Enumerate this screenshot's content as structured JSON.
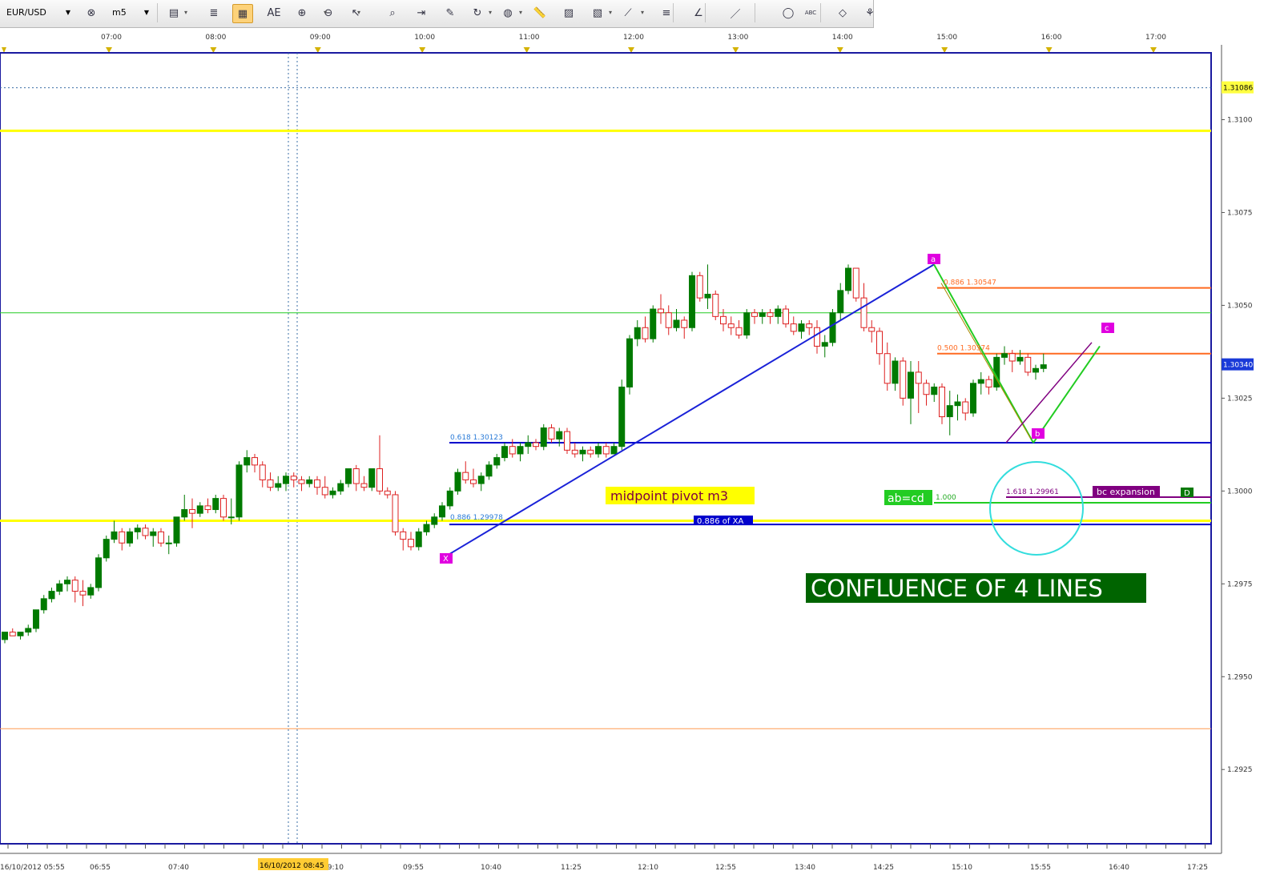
{
  "toolbar": {
    "symbol": "EUR/USD",
    "timeframe": "m5",
    "buttons": [
      {
        "name": "chart-type-icon",
        "glyph": "▤"
      },
      {
        "name": "indicator-icon",
        "glyph": "≣"
      },
      {
        "name": "data-window-icon",
        "glyph": "▦",
        "active": true
      },
      {
        "name": "text-icon",
        "glyph": "AE"
      },
      {
        "name": "zoom-in-icon",
        "glyph": "⊕"
      },
      {
        "name": "zoom-out-icon",
        "glyph": "⊖"
      },
      {
        "name": "cursor-icon",
        "glyph": "↖"
      },
      {
        "name": "zoom-area-icon",
        "glyph": "⌕"
      },
      {
        "name": "auto-scroll-icon",
        "glyph": "⇥"
      },
      {
        "name": "properties-icon",
        "glyph": "✎"
      },
      {
        "name": "refresh-icon",
        "glyph": "↻"
      },
      {
        "name": "globe-icon",
        "glyph": "◍"
      },
      {
        "name": "ruler-icon",
        "glyph": "📏"
      },
      {
        "name": "image-icon",
        "glyph": "▨"
      },
      {
        "name": "picture-icon",
        "glyph": "▧"
      },
      {
        "name": "line-tools-icon",
        "glyph": "⟋"
      },
      {
        "name": "fibonacci-icon",
        "glyph": "≡"
      },
      {
        "name": "angle-icon",
        "glyph": "∠"
      },
      {
        "name": "pen-icon",
        "glyph": "／"
      },
      {
        "name": "ellipse-icon",
        "glyph": "◯"
      },
      {
        "name": "abc-icon",
        "glyph": "ABC"
      },
      {
        "name": "eraser-icon",
        "glyph": "◇"
      },
      {
        "name": "hierarchy-icon",
        "glyph": "⚘"
      },
      {
        "name": "menu-icon",
        "glyph": "≡"
      }
    ]
  },
  "chart_data": {
    "type": "candlestick",
    "symbol": "EUR/USD",
    "timeframe": "m5",
    "top_time_labels": [
      "07:00",
      "08:00",
      "09:00",
      "10:00",
      "11:00",
      "12:00",
      "13:00",
      "14:00",
      "15:00",
      "16:00",
      "17:00"
    ],
    "bottom_time_labels": [
      "16/10/2012 05:55",
      "06:55",
      "07:40",
      "09:10",
      "09:55",
      "10:40",
      "11:25",
      "12:10",
      "12:55",
      "13:40",
      "14:25",
      "15:10",
      "15:55",
      "16:40",
      "17:25"
    ],
    "crosshair_time_label": "16/10/2012 08:45",
    "price_labels": [
      "1.3100",
      "1.3075",
      "1.3050",
      "1.3025",
      "1.3000",
      "1.2975",
      "1.2950",
      "1.2925"
    ],
    "ylim": [
      1.2905,
      1.3118
    ],
    "current_price_label": "1.30340",
    "current_price": 1.3034,
    "high_marker_label": "1.31086",
    "high_marker_price": 1.31086,
    "horizontal_lines": [
      {
        "price": 1.3097,
        "color": "#ffff00"
      },
      {
        "price": 1.2992,
        "color": "#ffff00"
      },
      {
        "price": 1.3048,
        "color": "#22cc22"
      },
      {
        "price": 1.2936,
        "color": "#ff9a50"
      },
      {
        "price": 1.30547,
        "color": "#ff6a20"
      },
      {
        "price": 1.3037,
        "color": "#ff6a20"
      },
      {
        "price": 1.3013,
        "color": "#0000cc"
      },
      {
        "price": 1.2991,
        "color": "#0000cc"
      }
    ],
    "pattern_labels": {
      "x": "X",
      "a": "a",
      "b": "b",
      "c": "c",
      "d": "D"
    },
    "annotations": {
      "fib_0618": "0.618 1.30123",
      "fib_0886_xa_line": "0.886 1.29978",
      "fib_0886_ab": "0.886 1.30547",
      "fib_0500": "0.500 1.30374",
      "fib_1618": "1.618 1.29961",
      "abcd_ratio": "1.000",
      "midpoint": "midpoint pivot m3",
      "xa_label": "0.886 of XA",
      "abcd": "ab=cd",
      "bc_expansion": "bc expansion",
      "confluence": "CONFLUENCE OF  4 LINES"
    },
    "candles": [
      [
        1.296,
        1.2962,
        1.2959,
        1.2962
      ],
      [
        1.2962,
        1.2963,
        1.2961,
        1.2961
      ],
      [
        1.2961,
        1.2962,
        1.296,
        1.2962
      ],
      [
        1.2962,
        1.2964,
        1.2961,
        1.2963
      ],
      [
        1.2963,
        1.2968,
        1.2962,
        1.2968
      ],
      [
        1.2968,
        1.2972,
        1.2967,
        1.2971
      ],
      [
        1.2971,
        1.2974,
        1.297,
        1.2973
      ],
      [
        1.2973,
        1.2976,
        1.2972,
        1.2975
      ],
      [
        1.2975,
        1.2977,
        1.2973,
        1.2976
      ],
      [
        1.2976,
        1.2977,
        1.297,
        1.2973
      ],
      [
        1.2973,
        1.2976,
        1.2969,
        1.2972
      ],
      [
        1.2972,
        1.2975,
        1.2971,
        1.2974
      ],
      [
        1.2974,
        1.2983,
        1.2973,
        1.2982
      ],
      [
        1.2982,
        1.2988,
        1.2981,
        1.2987
      ],
      [
        1.2987,
        1.2992,
        1.2986,
        1.2989
      ],
      [
        1.2989,
        1.299,
        1.2984,
        1.2986
      ],
      [
        1.2986,
        1.299,
        1.2985,
        1.2989
      ],
      [
        1.2989,
        1.2991,
        1.2987,
        1.299
      ],
      [
        1.299,
        1.2991,
        1.2987,
        1.2988
      ],
      [
        1.2988,
        1.299,
        1.2985,
        1.2989
      ],
      [
        1.2989,
        1.299,
        1.2985,
        1.2986
      ],
      [
        1.2986,
        1.2988,
        1.2983,
        1.2986
      ],
      [
        1.2986,
        1.2993,
        1.2985,
        1.2993
      ],
      [
        1.2993,
        1.2999,
        1.2992,
        1.2995
      ],
      [
        1.2995,
        1.2998,
        1.299,
        1.2994
      ],
      [
        1.2994,
        1.2997,
        1.2993,
        1.2996
      ],
      [
        1.2996,
        1.2998,
        1.2994,
        1.2995
      ],
      [
        1.2995,
        1.2999,
        1.2994,
        1.2998
      ],
      [
        1.2998,
        1.2999,
        1.2992,
        1.2993
      ],
      [
        1.2993,
        1.2998,
        1.2991,
        1.2993
      ],
      [
        1.2993,
        1.3008,
        1.2992,
        1.3007
      ],
      [
        1.3007,
        1.3011,
        1.3005,
        1.3009
      ],
      [
        1.3009,
        1.301,
        1.3005,
        1.3007
      ],
      [
        1.3007,
        1.3008,
        1.3001,
        1.3003
      ],
      [
        1.3003,
        1.3005,
        1.3,
        1.3001
      ],
      [
        1.3001,
        1.3004,
        1.3,
        1.3002
      ],
      [
        1.3002,
        1.3005,
        1.3,
        1.3004
      ],
      [
        1.3004,
        1.3005,
        1.3001,
        1.3003
      ],
      [
        1.3003,
        1.3004,
        1.3,
        1.3002
      ],
      [
        1.3002,
        1.3004,
        1.3001,
        1.3003
      ],
      [
        1.3003,
        1.3004,
        1.2999,
        1.3001
      ],
      [
        1.3001,
        1.3004,
        1.2998,
        1.2999
      ],
      [
        1.2999,
        1.3001,
        1.2998,
        1.3
      ],
      [
        1.3,
        1.3003,
        1.2999,
        1.3002
      ],
      [
        1.3002,
        1.3006,
        1.3001,
        1.3006
      ],
      [
        1.3006,
        1.3007,
        1.3,
        1.3002
      ],
      [
        1.3002,
        1.3004,
        1.3,
        1.3001
      ],
      [
        1.3001,
        1.3006,
        1.3,
        1.3006
      ],
      [
        1.3006,
        1.3015,
        1.2999,
        1.3
      ],
      [
        1.3,
        1.3001,
        1.2998,
        1.2999
      ],
      [
        1.2999,
        1.3,
        1.2988,
        1.2989
      ],
      [
        1.2989,
        1.299,
        1.2984,
        1.2987
      ],
      [
        1.2987,
        1.2989,
        1.2984,
        1.2985
      ],
      [
        1.2985,
        1.299,
        1.2984,
        1.2989
      ],
      [
        1.2989,
        1.2992,
        1.2988,
        1.2991
      ],
      [
        1.2991,
        1.2994,
        1.299,
        1.2993
      ],
      [
        1.2993,
        1.2997,
        1.2992,
        1.2996
      ],
      [
        1.2996,
        1.3001,
        1.2995,
        1.3
      ],
      [
        1.3,
        1.3006,
        1.2999,
        1.3005
      ],
      [
        1.3005,
        1.3008,
        1.3002,
        1.3003
      ],
      [
        1.3003,
        1.3006,
        1.3001,
        1.3002
      ],
      [
        1.3002,
        1.3005,
        1.3,
        1.3004
      ],
      [
        1.3004,
        1.3008,
        1.3003,
        1.3007
      ],
      [
        1.3007,
        1.301,
        1.3006,
        1.3009
      ],
      [
        1.3009,
        1.3013,
        1.3008,
        1.3012
      ],
      [
        1.3012,
        1.3014,
        1.3009,
        1.301
      ],
      [
        1.301,
        1.3013,
        1.3008,
        1.3012
      ],
      [
        1.3012,
        1.3015,
        1.301,
        1.3013
      ],
      [
        1.3013,
        1.3014,
        1.3011,
        1.3012
      ],
      [
        1.3012,
        1.3018,
        1.3011,
        1.3017
      ],
      [
        1.3017,
        1.3018,
        1.3013,
        1.3014
      ],
      [
        1.3014,
        1.3017,
        1.3012,
        1.3016
      ],
      [
        1.3016,
        1.3017,
        1.301,
        1.3011
      ],
      [
        1.3011,
        1.3013,
        1.3009,
        1.301
      ],
      [
        1.301,
        1.3012,
        1.3008,
        1.3011
      ],
      [
        1.3011,
        1.3012,
        1.3009,
        1.301
      ],
      [
        1.301,
        1.3013,
        1.3009,
        1.3012
      ],
      [
        1.3012,
        1.3013,
        1.3009,
        1.301
      ],
      [
        1.301,
        1.3013,
        1.301,
        1.3012
      ],
      [
        1.3012,
        1.303,
        1.3011,
        1.3028
      ],
      [
        1.3028,
        1.3042,
        1.3026,
        1.3041
      ],
      [
        1.3041,
        1.3046,
        1.3039,
        1.3044
      ],
      [
        1.3044,
        1.3047,
        1.304,
        1.3041
      ],
      [
        1.3041,
        1.305,
        1.304,
        1.3049
      ],
      [
        1.3049,
        1.3053,
        1.3045,
        1.3048
      ],
      [
        1.3048,
        1.305,
        1.3042,
        1.3044
      ],
      [
        1.3044,
        1.3049,
        1.3043,
        1.3046
      ],
      [
        1.3046,
        1.3047,
        1.3041,
        1.3044
      ],
      [
        1.3044,
        1.3059,
        1.3043,
        1.3058
      ],
      [
        1.3058,
        1.3059,
        1.3051,
        1.3052
      ],
      [
        1.3052,
        1.3061,
        1.3049,
        1.3053
      ],
      [
        1.3053,
        1.3054,
        1.3046,
        1.3047
      ],
      [
        1.3047,
        1.3049,
        1.3043,
        1.3045
      ],
      [
        1.3045,
        1.3047,
        1.3042,
        1.3044
      ],
      [
        1.3044,
        1.3046,
        1.3041,
        1.3042
      ],
      [
        1.3042,
        1.3049,
        1.3041,
        1.3048
      ],
      [
        1.3048,
        1.3049,
        1.3045,
        1.3047
      ],
      [
        1.3047,
        1.3049,
        1.3045,
        1.3048
      ],
      [
        1.3048,
        1.3049,
        1.3045,
        1.3047
      ],
      [
        1.3047,
        1.305,
        1.3045,
        1.3049
      ],
      [
        1.3049,
        1.305,
        1.3044,
        1.3045
      ],
      [
        1.3045,
        1.3047,
        1.3042,
        1.3043
      ],
      [
        1.3043,
        1.3046,
        1.3041,
        1.3045
      ],
      [
        1.3045,
        1.3046,
        1.3042,
        1.3044
      ],
      [
        1.3044,
        1.3046,
        1.3037,
        1.3039
      ],
      [
        1.3039,
        1.3042,
        1.3036,
        1.304
      ],
      [
        1.304,
        1.3049,
        1.3039,
        1.3048
      ],
      [
        1.3048,
        1.3056,
        1.3046,
        1.3054
      ],
      [
        1.3054,
        1.3061,
        1.3053,
        1.306
      ],
      [
        1.306,
        1.306,
        1.3051,
        1.3052
      ],
      [
        1.3052,
        1.3056,
        1.3043,
        1.3044
      ],
      [
        1.3044,
        1.3046,
        1.304,
        1.3043
      ],
      [
        1.3043,
        1.3044,
        1.3034,
        1.3037
      ],
      [
        1.3037,
        1.304,
        1.3027,
        1.3029
      ],
      [
        1.3029,
        1.3036,
        1.3027,
        1.3035
      ],
      [
        1.3035,
        1.3036,
        1.3023,
        1.3025
      ],
      [
        1.3025,
        1.3035,
        1.3018,
        1.3032
      ],
      [
        1.3032,
        1.3035,
        1.3021,
        1.3029
      ],
      [
        1.3029,
        1.303,
        1.3023,
        1.3026
      ],
      [
        1.3026,
        1.3029,
        1.3024,
        1.3028
      ],
      [
        1.3028,
        1.3029,
        1.3018,
        1.302
      ],
      [
        1.302,
        1.3027,
        1.3015,
        1.3023
      ],
      [
        1.3023,
        1.3026,
        1.3019,
        1.3024
      ],
      [
        1.3024,
        1.3025,
        1.3019,
        1.3021
      ],
      [
        1.3021,
        1.303,
        1.302,
        1.3029
      ],
      [
        1.3029,
        1.3032,
        1.3026,
        1.303
      ],
      [
        1.303,
        1.3031,
        1.3026,
        1.3028
      ],
      [
        1.3028,
        1.3037,
        1.3027,
        1.3036
      ],
      [
        1.3036,
        1.3039,
        1.3034,
        1.3037
      ],
      [
        1.3037,
        1.3038,
        1.3032,
        1.3035
      ],
      [
        1.3035,
        1.3038,
        1.3034,
        1.3036
      ],
      [
        1.3036,
        1.3037,
        1.3031,
        1.3032
      ],
      [
        1.3032,
        1.3034,
        1.303,
        1.3033
      ],
      [
        1.3033,
        1.3037,
        1.3032,
        1.3034
      ]
    ]
  }
}
